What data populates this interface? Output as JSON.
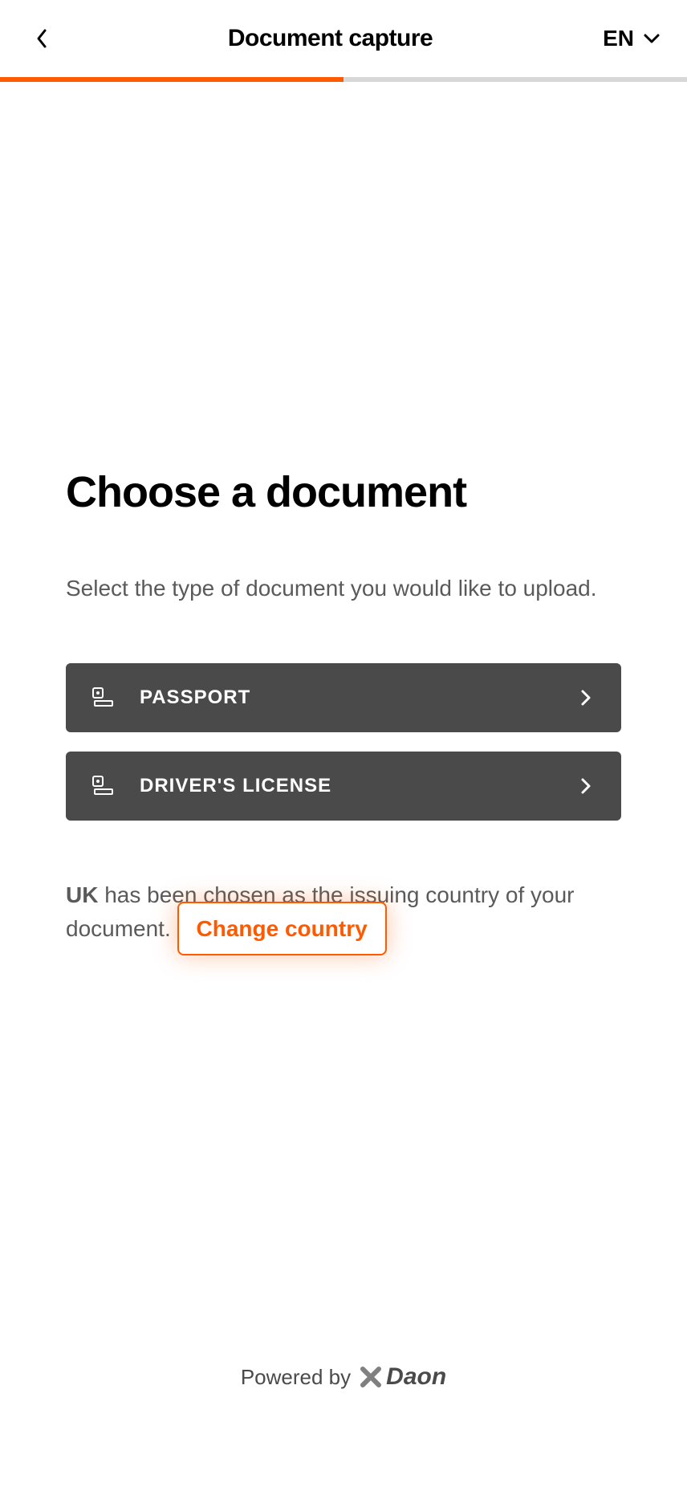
{
  "header": {
    "title": "Document capture",
    "language": "EN"
  },
  "progress": {
    "percent": 50
  },
  "page": {
    "title": "Choose a document",
    "subtitle": "Select the type of document you would like to upload."
  },
  "options": [
    {
      "label": "PASSPORT"
    },
    {
      "label": "DRIVER'S LICENSE"
    }
  ],
  "country": {
    "selected": "UK",
    "text_middle": " has been chosen as the issuing country of your document. ",
    "change_label": "Change country"
  },
  "footer": {
    "powered_by": "Powered by",
    "brand": "Daon"
  }
}
